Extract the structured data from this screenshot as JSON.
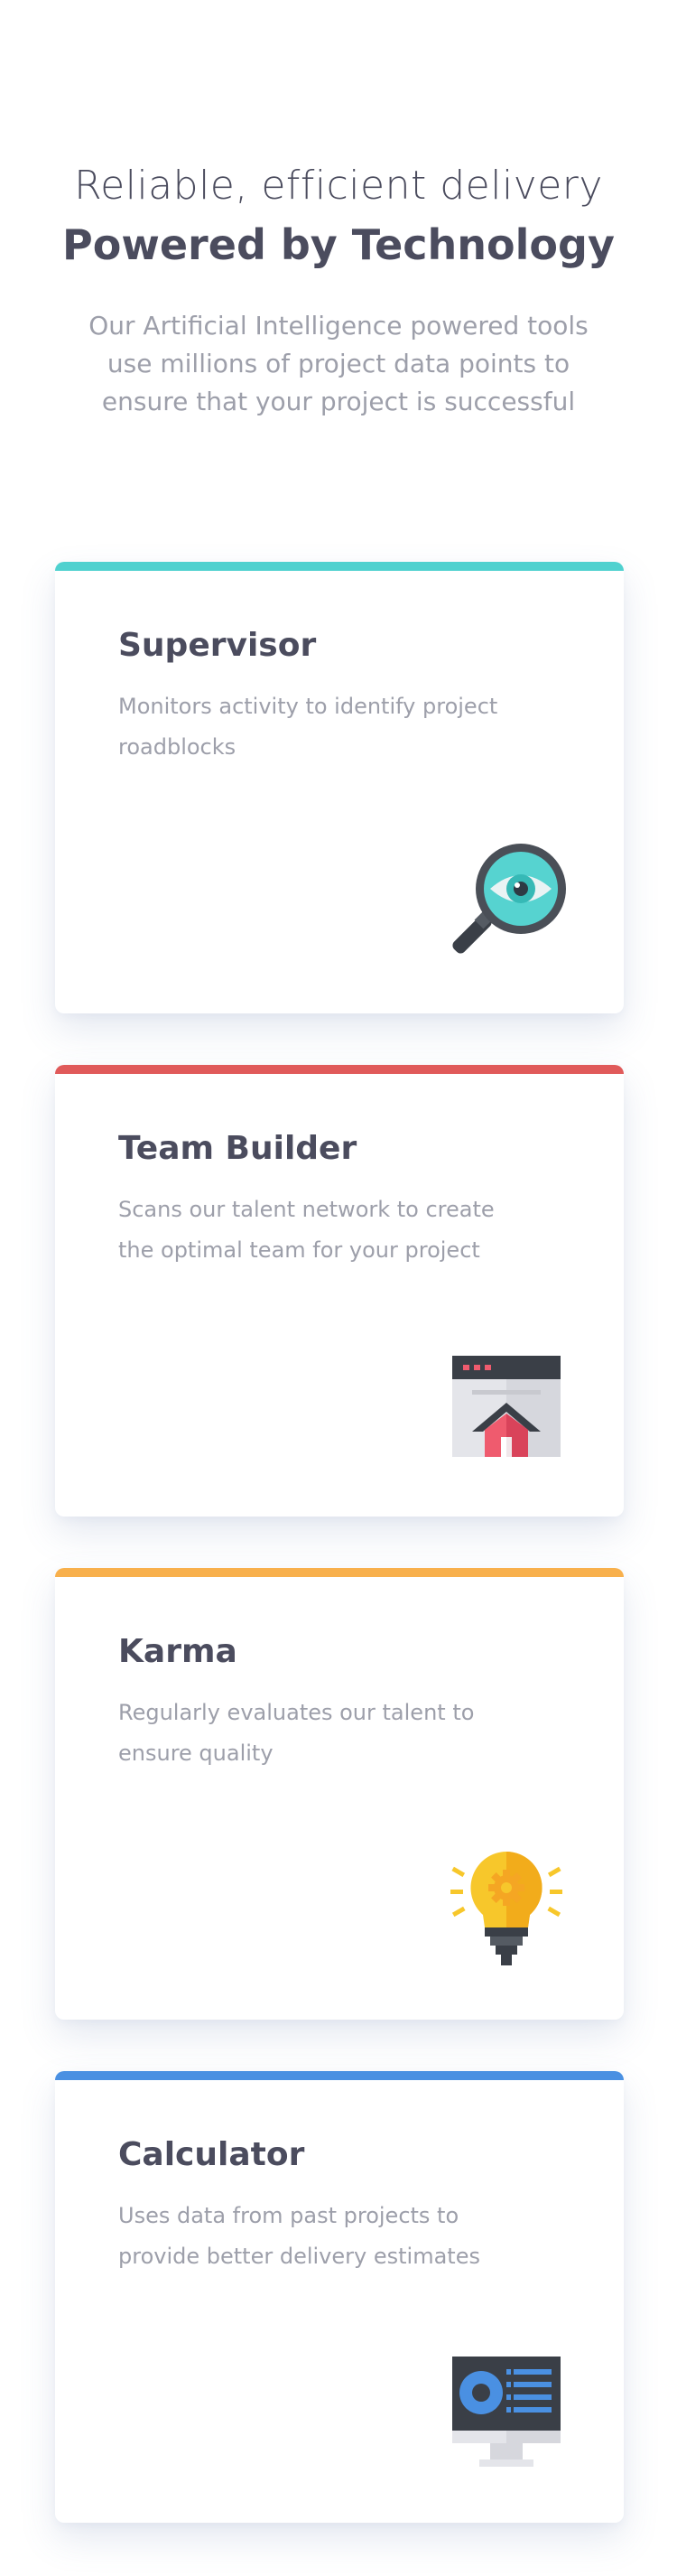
{
  "hero": {
    "kicker": "Reliable, efficient delivery",
    "title": "Powered by Technology",
    "description": "Our Artificial Intelligence powered tools use millions of project data points to ensure that your project is successful"
  },
  "cards": [
    {
      "title": "Supervisor",
      "description": "Monitors activity to identify project roadblocks",
      "accent": "#4fd1cf",
      "icon": "magnifier-eye-icon"
    },
    {
      "title": "Team Builder",
      "description": "Scans our talent network to create the optimal team for your project",
      "accent": "#e05a5a",
      "icon": "browser-home-icon"
    },
    {
      "title": "Karma",
      "description": "Regularly evaluates our talent to ensure quality",
      "accent": "#f8b04c",
      "icon": "lightbulb-gear-icon"
    },
    {
      "title": "Calculator",
      "description": "Uses data from past projects to provide better delivery estimates",
      "accent": "#4a90e2",
      "icon": "monitor-dashboard-icon"
    }
  ]
}
